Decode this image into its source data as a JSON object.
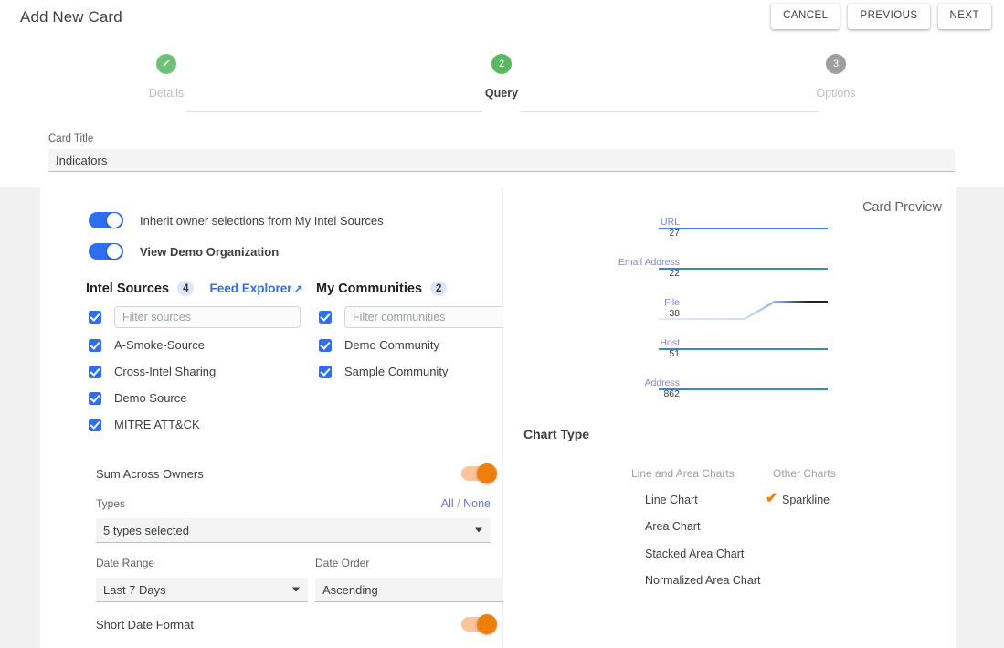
{
  "header": {
    "title": "Add New Card",
    "buttons": [
      {
        "label": "CANCEL",
        "name": "cancel-button"
      },
      {
        "label": "PREVIOUS",
        "name": "previous-button"
      },
      {
        "label": "NEXT",
        "name": "next-button"
      }
    ]
  },
  "stepper": {
    "steps": [
      {
        "label": "Details",
        "marker": "✔",
        "state": "done"
      },
      {
        "label": "Query",
        "marker": "2",
        "state": "active"
      },
      {
        "label": "Options",
        "marker": "3",
        "state": "todo"
      }
    ],
    "colors": {
      "done": "#6ec177",
      "active": "#5cb860",
      "todo": "#9e9e9e"
    }
  },
  "card_title": {
    "label": "Card Title",
    "value": "Indicators",
    "placeholder": "Card Title"
  },
  "left_panel": {
    "toggles": {
      "inherit": {
        "label": "Inherit owner selections from My Intel Sources",
        "on": true,
        "color": "#2f6fed"
      },
      "view_org": {
        "label": "View Demo Organization",
        "on": true,
        "color": "#2f6fed"
      },
      "sum_across_owners": {
        "label": "Sum Across Owners",
        "on": true,
        "color": "#f07f09"
      },
      "short_date_format": {
        "label": "Short Date Format",
        "on": true,
        "color": "#f07f09"
      }
    },
    "intel_sources": {
      "heading": "Intel Sources",
      "count": "4",
      "link": "Feed Explorer",
      "link_arrow": "↗",
      "filter_placeholder": "Filter sources",
      "filter_value": "",
      "items": [
        {
          "label": "A-Smoke-Source",
          "checked": true
        },
        {
          "label": "Cross-Intel Sharing",
          "checked": true
        },
        {
          "label": "Demo Source",
          "checked": true
        },
        {
          "label": "MITRE ATT&CK",
          "checked": true
        }
      ]
    },
    "my_communities": {
      "heading": "My Communities",
      "count": "2",
      "filter_placeholder": "Filter communities",
      "filter_value": "",
      "items": [
        {
          "label": "Demo Community",
          "checked": true
        },
        {
          "label": "Sample Community",
          "checked": true
        }
      ]
    },
    "types": {
      "label": "Types",
      "all": "All",
      "separator": "/",
      "none": "None",
      "value": "5 types selected"
    },
    "date_range": {
      "label": "Date Range",
      "value": "Last 7 Days"
    },
    "date_order": {
      "label": "Date Order",
      "value": "Ascending"
    }
  },
  "right_panel": {
    "preview_title": "Card Preview",
    "chart_type": {
      "heading": "Chart Type",
      "columns": [
        {
          "heading": "Line and Area Charts",
          "options": [
            {
              "label": "Line Chart",
              "selected": false
            },
            {
              "label": "Area Chart",
              "selected": false
            },
            {
              "label": "Stacked Area Chart",
              "selected": false
            },
            {
              "label": "Normalized Area Chart",
              "selected": false
            }
          ]
        },
        {
          "heading": "Other Charts",
          "options": [
            {
              "label": "Sparkline",
              "selected": true
            }
          ]
        }
      ],
      "check_glyph": "✔",
      "check_color": "#f07f09"
    }
  },
  "chart_data": {
    "type": "line",
    "title": "Card Preview",
    "subtype": "sparkline",
    "xlabel": "",
    "ylabel": "",
    "grid": false,
    "legend": "none",
    "line_color": "#3b82e0",
    "highlight_color": "#222222",
    "muted_color": "#cfe1fa",
    "series": [
      {
        "name": "URL",
        "value": 27,
        "flat": true,
        "highlighted": false,
        "values": [
          27,
          27,
          27,
          27,
          27
        ]
      },
      {
        "name": "Email Address",
        "value": 22,
        "flat": true,
        "highlighted": false,
        "values": [
          22,
          22,
          22,
          22,
          22
        ]
      },
      {
        "name": "File",
        "value": 38,
        "flat": false,
        "highlighted": true,
        "values": [
          10,
          10,
          10,
          38,
          38
        ]
      },
      {
        "name": "Host",
        "value": 51,
        "flat": true,
        "highlighted": false,
        "values": [
          51,
          51,
          51,
          51,
          51
        ]
      },
      {
        "name": "Address",
        "value": 862,
        "flat": true,
        "highlighted": false,
        "values": [
          862,
          862,
          862,
          862,
          862
        ]
      }
    ]
  }
}
